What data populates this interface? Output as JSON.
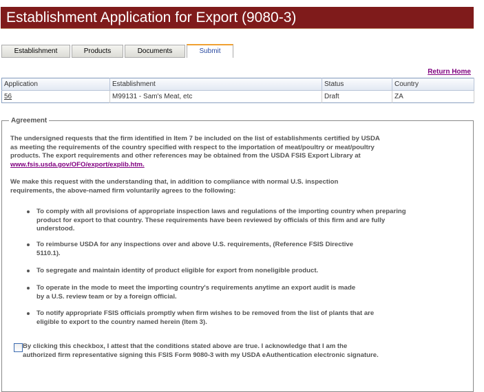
{
  "title": "Establishment Application for Export (9080-3)",
  "tabs": [
    "Establishment",
    "Products",
    "Documents",
    "Submit"
  ],
  "return_home": "Return Home",
  "table": {
    "headers": [
      "Application",
      "Establishment",
      "Status",
      "Country"
    ],
    "row": [
      "56",
      "M99131 - Sam's Meat, etc",
      "Draft",
      "ZA"
    ]
  },
  "agreement": {
    "legend": "Agreement",
    "p1": "The undersigned requests that the firm identified in Item 7 be included on the list of establishments certified by USDA as meeting the requirements of the country specified with respect to the importation of meat/poultry or meat/poultry products. The export requirements and other references may be obtained from the USDA FSIS Export Library at",
    "link": "www.fsis.usda.gov/OFO/export/explib.htm.",
    "p2": "We make this request with the understanding that, in addition to compliance with normal U.S. inspection requirements, the above-named firm voluntarily agrees to the following:",
    "items": [
      "To comply with all provisions of appropriate inspection laws and regulations of the importing country when preparing product for export to that country. These requirements have been reviewed by officials of this firm and are fully understood.",
      "To reimburse USDA for any inspections over and above U.S. requirements, (Reference FSIS Directive 5110.1).",
      "To segregate and maintain identity of product eligible for export from noneligible product.",
      "To operate in the mode to meet the importing country's requirements anytime an export audit is made by a U.S. review team or by a foreign official.",
      "To notify appropriate FSIS officials promptly when firm wishes to be removed from the list of plants that are eligible to export to the country named herein (Item 3)."
    ],
    "checkbox_label": "By clicking this checkbox, I attest that the conditions stated above are true. I acknowledge that I am the authorized firm representative signing this FSIS Form 9080-3 with my USDA eAuthentication electronic signature."
  }
}
